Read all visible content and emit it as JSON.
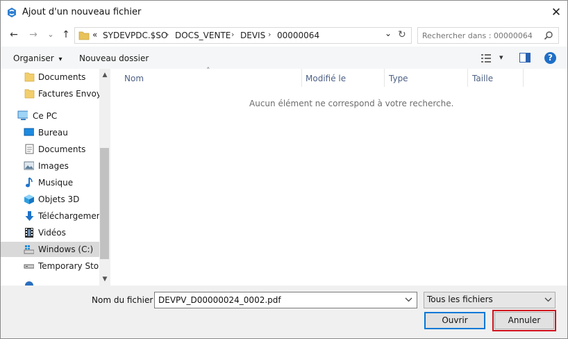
{
  "dialog": {
    "title": "Ajout d'un nouveau fichier",
    "close": "✕"
  },
  "nav": {
    "back": "←",
    "forward": "→",
    "recent": "⌄",
    "up": "↑"
  },
  "address": {
    "overflow": "«",
    "crumbs": [
      "SYDEVPDC.$SO",
      "DOCS_VENTE",
      "DEVIS",
      "00000064"
    ],
    "separator": "›",
    "dropdown": "⌄",
    "refresh": "↻"
  },
  "search": {
    "placeholder": "Rechercher dans : 00000064"
  },
  "toolbar": {
    "organize": "Organiser",
    "organize_arrow": "▾",
    "new_folder": "Nouveau dossier",
    "view_arrow": "▾",
    "help": "?"
  },
  "sidebar": {
    "items": [
      {
        "label": "Documents",
        "icon": "folder-icon"
      },
      {
        "label": "Factures Envoye",
        "icon": "folder-icon"
      },
      {
        "label": "Ce PC",
        "icon": "computer-icon"
      },
      {
        "label": "Bureau",
        "icon": "desktop-icon"
      },
      {
        "label": "Documents",
        "icon": "documents-icon"
      },
      {
        "label": "Images",
        "icon": "images-icon"
      },
      {
        "label": "Musique",
        "icon": "music-icon"
      },
      {
        "label": "Objets 3D",
        "icon": "3d-objects-icon"
      },
      {
        "label": "Téléchargement",
        "icon": "download-icon"
      },
      {
        "label": "Vidéos",
        "icon": "video-icon"
      },
      {
        "label": "Windows (C:)",
        "icon": "windows-drive-icon"
      },
      {
        "label": "Temporary Stora",
        "icon": "drive-icon"
      }
    ],
    "scroll_up": "▲",
    "scroll_down": "▼"
  },
  "file_list": {
    "columns": [
      "Nom",
      "Modifié le",
      "Type",
      "Taille"
    ],
    "sort_indicator": "˄",
    "empty_message": "Aucun élément ne correspond à votre recherche."
  },
  "footer": {
    "filename_label": "Nom du fichier :",
    "filename_value": "DEVPV_D00000024_0002.pdf",
    "filter_value": "Tous les fichiers",
    "open_label": "Ouvrir",
    "cancel_label": "Annuler"
  },
  "colors": {
    "accent": "#0078d7",
    "highlight_outline": "#d0101d",
    "folder": "#e8c25a",
    "selected_row": "#d9d9d9"
  }
}
